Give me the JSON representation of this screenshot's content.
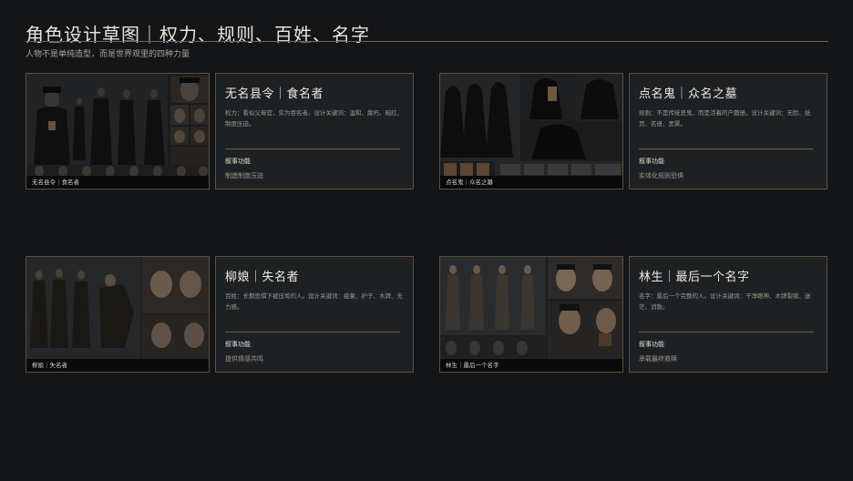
{
  "header": {
    "title": "角色设计草图｜权力、规则、百姓、名字",
    "subtitle": "人物不是单纯造型，而是世界观里的四种力量"
  },
  "characters": [
    {
      "caption": "无名县令｜食名者",
      "name": "无名县令｜食名者",
      "description": "权力：看似父母官，实为吞名者。设计关键词：温和、腐朽、暗红、制度压迫。",
      "function_label": "叙事功能",
      "function_value": "制造制度压迫"
    },
    {
      "caption": "点名鬼｜众名之墓",
      "name": "点名鬼｜众名之墓",
      "description": "规则：不是传统恶鬼，而是活着的户籍册。设计关键词：无脸、纸页、名册、黑雾。",
      "function_label": "叙事功能",
      "function_value": "实体化规则恐惧"
    },
    {
      "caption": "柳娘｜失名者",
      "name": "柳娘｜失名者",
      "description": "百姓：长期恐惧下被压垮的人。设计关键词：疲惫、护子、木牌、无力感。",
      "function_label": "叙事功能",
      "function_value": "提供情感共鸣"
    },
    {
      "caption": "林生｜最后一个名字",
      "name": "林生｜最后一个名字",
      "description": "名字：最后一个完整的人。设计关键词：干净眼神、木牌裂痕、迷茫、消散。",
      "function_label": "叙事功能",
      "function_value": "承载最终救赎"
    }
  ],
  "colors": {
    "background": "#141517",
    "card": "#1e2124",
    "border": "#5a5140",
    "accent_rule": "#6e6450"
  }
}
